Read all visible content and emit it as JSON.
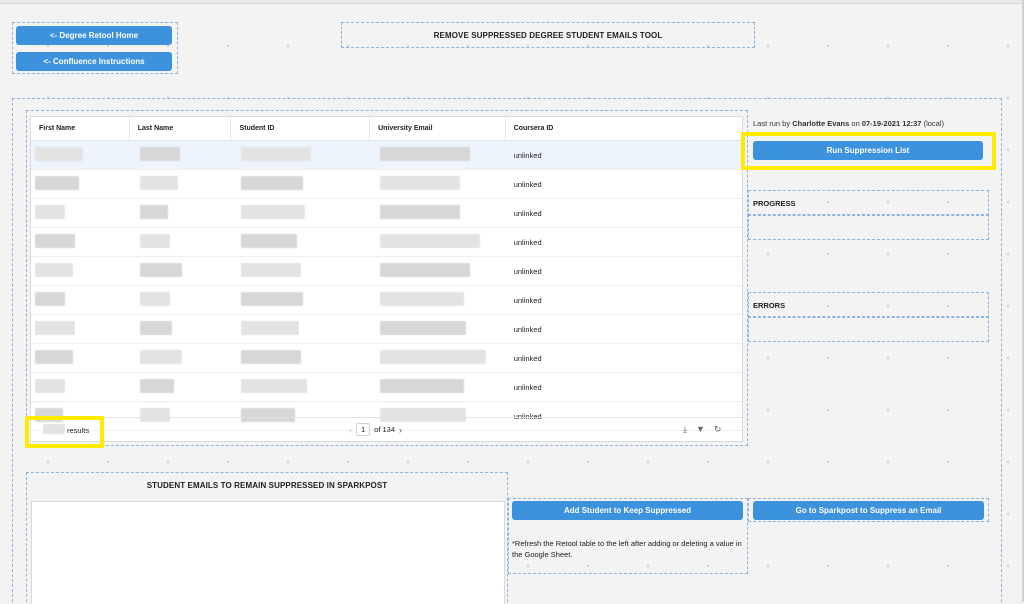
{
  "nav": {
    "home_label": "<- Degree Retool Home",
    "confluence_label": "<- Confluence Instructions"
  },
  "header": {
    "title": "REMOVE SUPPRESSED DEGREE STUDENT EMAILS TOOL"
  },
  "table": {
    "columns": [
      "First Name",
      "Last Name",
      "Student ID",
      "University Email",
      "Coursera ID"
    ],
    "rows": [
      {
        "coursera_id": "unlinked"
      },
      {
        "coursera_id": "unlinked"
      },
      {
        "coursera_id": "unlinked"
      },
      {
        "coursera_id": "unlinked"
      },
      {
        "coursera_id": "unlinked"
      },
      {
        "coursera_id": "unlinked"
      },
      {
        "coursera_id": "unlinked"
      },
      {
        "coursera_id": "unlinked"
      },
      {
        "coursera_id": "unlinked"
      },
      {
        "coursera_id": "unlinked"
      }
    ],
    "results_suffix": "results",
    "pagination": {
      "current_page": "1",
      "of_pages": "of 134"
    }
  },
  "run_panel": {
    "last_run_prefix": "Last run by",
    "last_run_user": "Charlotte Evans",
    "last_run_on": "on",
    "last_run_time": "07-19-2021 12:37",
    "last_run_tz": "(local)",
    "run_button_label": "Run Suppression List",
    "progress_label": "PROGRESS",
    "errors_label": "ERRORS"
  },
  "bottom": {
    "remain_title": "STUDENT EMAILS TO REMAIN SUPPRESSED IN SPARKPOST",
    "add_button_label": "Add Student to Keep Suppressed",
    "sparkpost_button_label": "Go to Sparkpost to Suppress an Email",
    "refresh_note": "*Refresh the Retool table to the left after adding or deleting a value in the Google Sheet."
  },
  "colors": {
    "primary": "#3c92dc",
    "highlight": "#ffeb00",
    "selected_row": "#edf4fc"
  }
}
